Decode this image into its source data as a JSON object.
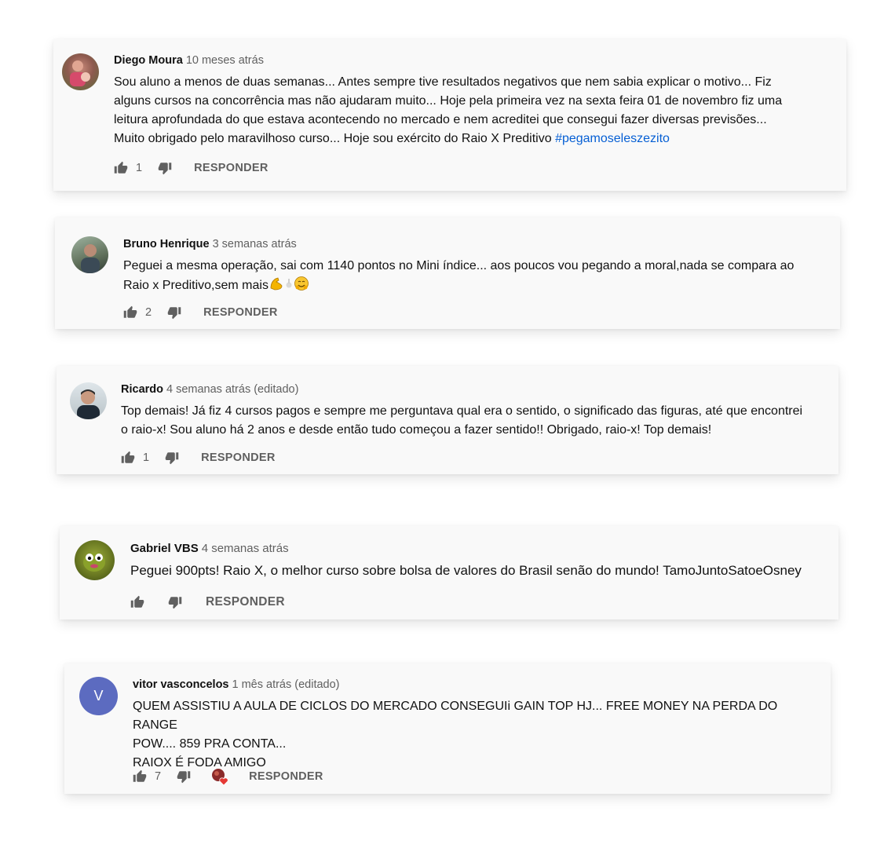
{
  "comments": [
    {
      "author": "Diego Moura",
      "time": "10 meses atrás",
      "lines": [
        "Sou aluno a menos de duas semanas... Antes sempre tive resultados negativos que nem sabia explicar o motivo... Fiz",
        "alguns cursos na concorrência mas não ajudaram muito... Hoje pela primeira vez na sexta feira 01 de novembro fiz uma",
        "leitura aprofundada do que estava acontecendo no mercado e nem acreditei que consegui fazer diversas previsões...",
        "Muito obrigado pelo maravilhoso curso... Hoje sou exército do Raio X Preditivo "
      ],
      "hashtag": "#pegamoseleszezito",
      "likes": "1",
      "reply": "RESPONDER"
    },
    {
      "author": "Bruno Henrique",
      "time": "3 semanas atrás",
      "lines": [
        "Peguei a mesma operação, sai com 1140 pontos no Mini índice... aos poucos vou pegando a moral,nada se compara ao",
        "Raio x Preditivo,sem mais"
      ],
      "likes": "2",
      "reply": "RESPONDER"
    },
    {
      "author": "Ricardo",
      "time": "4 semanas atrás (editado)",
      "lines": [
        "Top demais! Já fiz 4 cursos pagos e sempre me perguntava qual era o sentido, o significado das figuras, até que encontrei",
        "o raio-x!  Sou aluno há 2 anos e desde então tudo começou a fazer sentido!! Obrigado, raio-x! Top demais!"
      ],
      "likes": "1",
      "reply": "RESPONDER"
    },
    {
      "author": "Gabriel VBS",
      "time": "4 semanas atrás",
      "lines": [
        "Peguei 900pts! Raio X, o melhor curso sobre bolsa de valores do Brasil senão do mundo! TamoJuntoSatoeOsney"
      ],
      "likes": "",
      "reply": "RESPONDER"
    },
    {
      "author": "vitor vasconcelos",
      "time": "1 mês atrás (editado)",
      "avatar_letter": "V",
      "lines": [
        "QUEM ASSISTIU A AULA DE CICLOS DO MERCADO CONSEGUIi GAIN TOP HJ... FREE MONEY NA PERDA DO RANGE",
        "POW.... 859 PRA CONTA...",
        "RAIOX É FODA AMIGO"
      ],
      "likes": "7",
      "reply": "RESPONDER"
    }
  ],
  "colors": {
    "hashtag": "#065fd4",
    "avatar_letter_bg": "#5c6bc0",
    "heart": "#e53935"
  }
}
